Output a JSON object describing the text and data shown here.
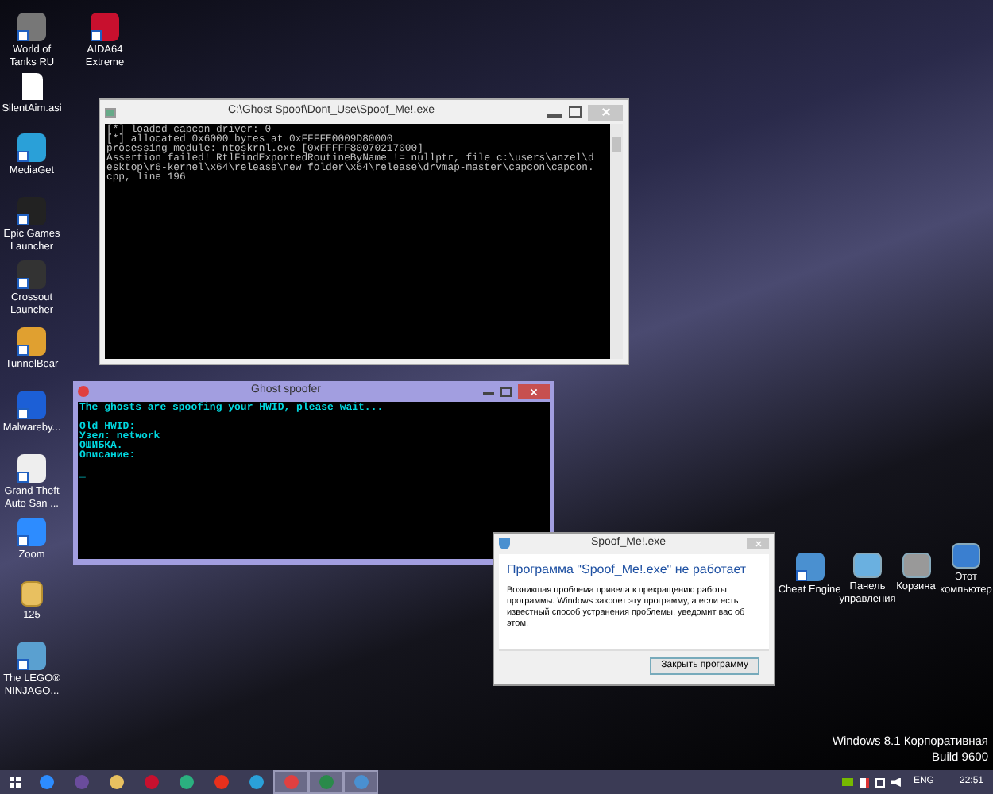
{
  "desktop_icons": [
    {
      "label": "World of Tanks RU",
      "kind": "shortcut"
    },
    {
      "label": "AIDA64 Extreme",
      "kind": "shortcut"
    },
    {
      "label": "SilentAim.asi",
      "kind": "file"
    },
    {
      "label": "MediaGet",
      "kind": "shortcut"
    },
    {
      "label": "Epic Games Launcher",
      "kind": "shortcut"
    },
    {
      "label": "Crossout Launcher",
      "kind": "shortcut"
    },
    {
      "label": "TunnelBear",
      "kind": "shortcut"
    },
    {
      "label": "Malwareby...",
      "kind": "shortcut"
    },
    {
      "label": "Grand Theft Auto San ...",
      "kind": "shortcut"
    },
    {
      "label": "Zoom",
      "kind": "shortcut"
    },
    {
      "label": "125",
      "kind": "folder"
    },
    {
      "label": "The LEGO® NINJAGO...",
      "kind": "shortcut"
    },
    {
      "label": "Cheat Engine",
      "kind": "shortcut"
    },
    {
      "label": "Панель управления",
      "kind": "system"
    },
    {
      "label": "Корзина",
      "kind": "system"
    },
    {
      "label": "Этот компьютер",
      "kind": "system"
    }
  ],
  "console_window": {
    "title": "C:\\Ghost Spoof\\Dont_Use\\Spoof_Me!.exe",
    "lines": [
      "[*] loaded capcon driver: 0",
      "[*] allocated 0x6000 bytes at 0xFFFFE0009D80000",
      "processing module: ntoskrnl.exe [0xFFFFF80070217000]",
      "Assertion failed! RtlFindExportedRoutineByName != nullptr, file c:\\users\\anzel\\d",
      "esktop\\r6-kernel\\x64\\release\\new folder\\x64\\release\\drvmap-master\\capcon\\capcon.",
      "cpp, line 196"
    ]
  },
  "spoofer_window": {
    "title": "Ghost spoofer",
    "paragraphs": [
      [
        "The ghosts are spoofing your HWID, please wait..."
      ],
      [
        "Old HWID:",
        "Узел: network",
        "ОШИБКА.",
        "Описание:"
      ],
      [
        "_"
      ]
    ]
  },
  "error_dialog": {
    "title": "Spoof_Me!.exe",
    "heading": "Программа \"Spoof_Me!.exe\" не работает",
    "message": "Возникшая проблема привела к прекращению работы программы. Windows закроет эту программу, а если есть известный способ устранения проблемы, уведомит вас об этом.",
    "button": "Закрыть программу"
  },
  "os_notice": [
    "Windows 8.1 Корпоративная",
    "Build 9600"
  ],
  "taskbar": {
    "items": [
      {
        "selected": false
      },
      {
        "selected": false
      },
      {
        "selected": false
      },
      {
        "selected": false
      },
      {
        "selected": false
      },
      {
        "selected": false
      },
      {
        "selected": false
      },
      {
        "selected": true
      },
      {
        "selected": true
      },
      {
        "selected": true
      }
    ],
    "language": "ENG",
    "time": "22:51"
  }
}
